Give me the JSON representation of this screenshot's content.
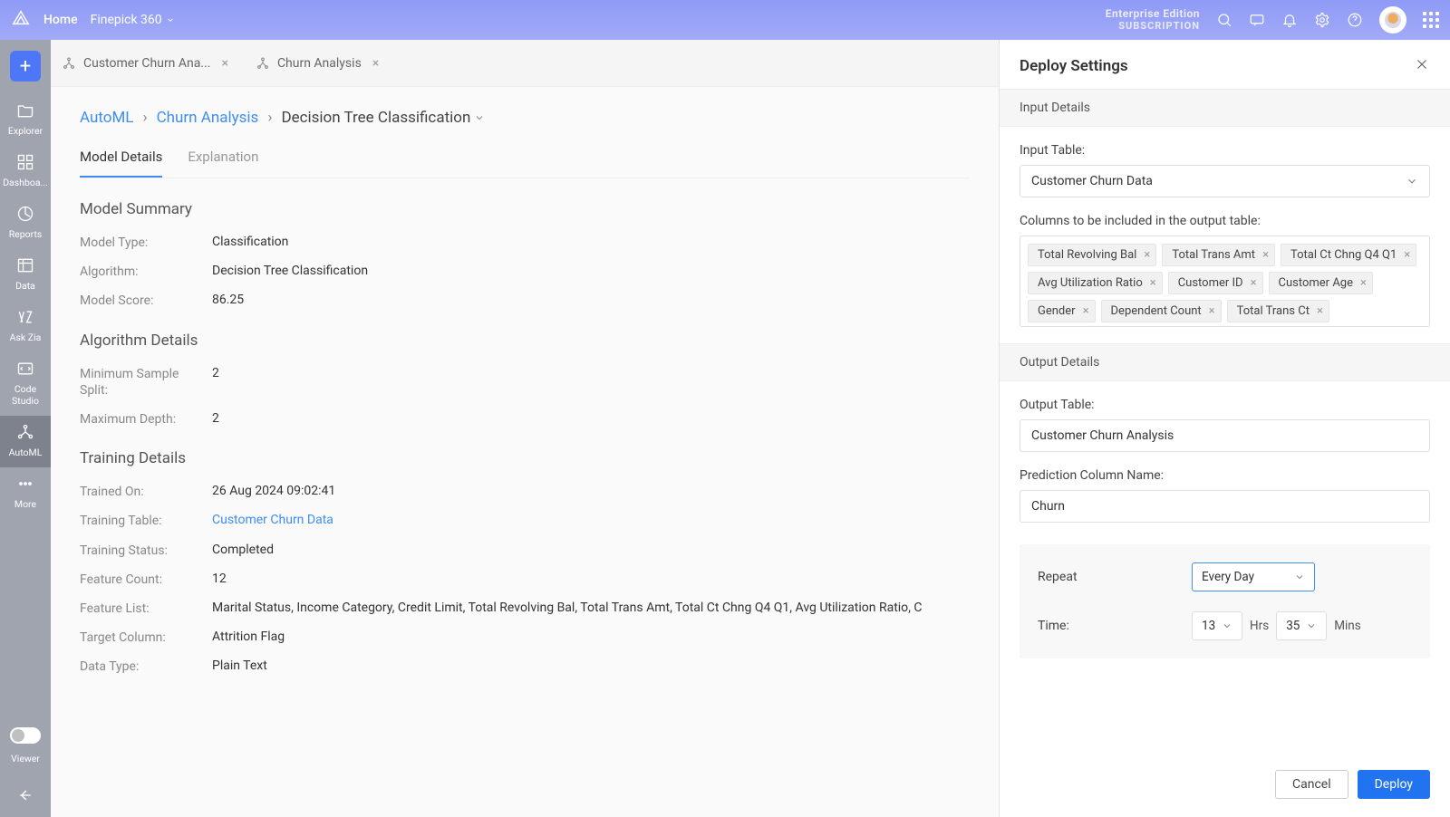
{
  "topbar": {
    "home": "Home",
    "workspace": "Finepick 360",
    "edition_title": "Enterprise Edition",
    "edition_sub": "SUBSCRIPTION"
  },
  "sidebar": {
    "items": [
      {
        "label": "Explorer"
      },
      {
        "label": "Dashboa..."
      },
      {
        "label": "Reports"
      },
      {
        "label": "Data"
      },
      {
        "label": "Ask Zia"
      },
      {
        "label": "Code Studio"
      },
      {
        "label": "AutoML"
      },
      {
        "label": "More"
      }
    ],
    "viewer": "Viewer"
  },
  "tabs": [
    {
      "label": "Customer Churn Ana..."
    },
    {
      "label": "Churn Analysis"
    }
  ],
  "breadcrumb": {
    "root": "AutoML",
    "mid": "Churn Analysis",
    "leaf": "Decision Tree Classification"
  },
  "subtabs": {
    "model_details": "Model Details",
    "explanation": "Explanation"
  },
  "sections": {
    "model_summary": "Model Summary",
    "algorithm_details": "Algorithm Details",
    "training_details": "Training Details"
  },
  "model_summary": {
    "model_type_label": "Model Type:",
    "model_type": "Classification",
    "algorithm_label": "Algorithm:",
    "algorithm": "Decision Tree Classification",
    "model_score_label": "Model Score:",
    "model_score": "86.25"
  },
  "algorithm_details": {
    "min_split_label": "Minimum Sample Split:",
    "min_split": "2",
    "max_depth_label": "Maximum Depth:",
    "max_depth": "2"
  },
  "training_details": {
    "trained_on_label": "Trained On:",
    "trained_on": "26 Aug 2024 09:02:41",
    "training_table_label": "Training Table:",
    "training_table": "Customer Churn Data",
    "training_status_label": "Training Status:",
    "training_status": "Completed",
    "feature_count_label": "Feature Count:",
    "feature_count": "12",
    "feature_list_label": "Feature List:",
    "feature_list": "Marital Status, Income Category, Credit Limit, Total Revolving Bal, Total Trans Amt, Total Ct Chng Q4 Q1, Avg Utilization Ratio, C",
    "target_column_label": "Target Column:",
    "target_column": "Attrition Flag",
    "data_type_label": "Data Type:",
    "data_type": "Plain Text"
  },
  "panel": {
    "title": "Deploy Settings",
    "input_details": "Input Details",
    "input_table_label": "Input Table:",
    "input_table": "Customer Churn Data",
    "columns_label": "Columns to be included in the output table:",
    "chips": [
      "Total Revolving Bal",
      "Total Trans Amt",
      "Total Ct Chng Q4 Q1",
      "Avg Utilization Ratio",
      "Customer ID",
      "Customer Age",
      "Gender",
      "Dependent Count",
      "Total Trans Ct"
    ],
    "output_details": "Output Details",
    "output_table_label": "Output Table:",
    "output_table": "Customer Churn Analysis",
    "prediction_col_label": "Prediction Column Name:",
    "prediction_col": "Churn",
    "repeat_label": "Repeat",
    "repeat_value": "Every Day",
    "time_label": "Time:",
    "time_hrs": "13",
    "hrs_unit": "Hrs",
    "time_mins": "35",
    "mins_unit": "Mins",
    "cancel": "Cancel",
    "deploy": "Deploy"
  }
}
